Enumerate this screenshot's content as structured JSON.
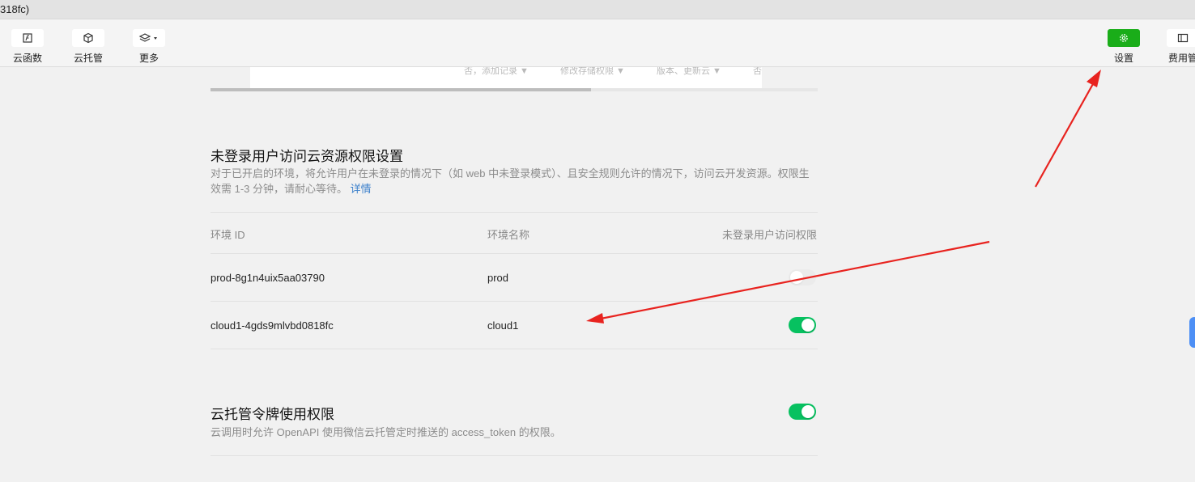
{
  "window": {
    "title_fragment": "318fc)"
  },
  "toolbar": {
    "left": [
      {
        "label": "云函数",
        "icon": "cloud-function-icon"
      },
      {
        "label": "云托管",
        "icon": "cube-icon"
      },
      {
        "label": "更多",
        "icon": "layers-dropdown-icon"
      }
    ],
    "right": [
      {
        "label": "设置",
        "icon": "gear-icon"
      },
      {
        "label": "费用管",
        "icon": "panel-icon"
      }
    ]
  },
  "previous_table": {
    "row_fragments": [
      "否，添加记录 ▼",
      "修改存储权限 ▼",
      "版本、更新云 ▼",
      "否"
    ]
  },
  "unauth_section": {
    "title": "未登录用户访问云资源权限设置",
    "description": "对于已开启的环境，将允许用户在未登录的情况下（如 web 中未登录模式）、且安全规则允许的情况下，访问云开发资源。权限生效需 1-3 分钟，请耐心等待。",
    "link": "详情",
    "columns": [
      "环境 ID",
      "环境名称",
      "未登录用户访问权限"
    ],
    "rows": [
      {
        "env_id": "prod-8g1n4uix5aa03790",
        "env_name": "prod",
        "enabled": false
      },
      {
        "env_id": "cloud1-4gds9mlvbd0818fc",
        "env_name": "cloud1",
        "enabled": true
      }
    ]
  },
  "token_section": {
    "title": "云托管令牌使用权限",
    "description": "云调用时允许 OpenAPI 使用微信云托管定时推送的 access_token 的权限。",
    "enabled": true
  },
  "colors": {
    "accent_green": "#07c160",
    "settings_button": "#1aad19",
    "link_blue": "#3a7fcb",
    "annotation_red": "#e8231f"
  }
}
